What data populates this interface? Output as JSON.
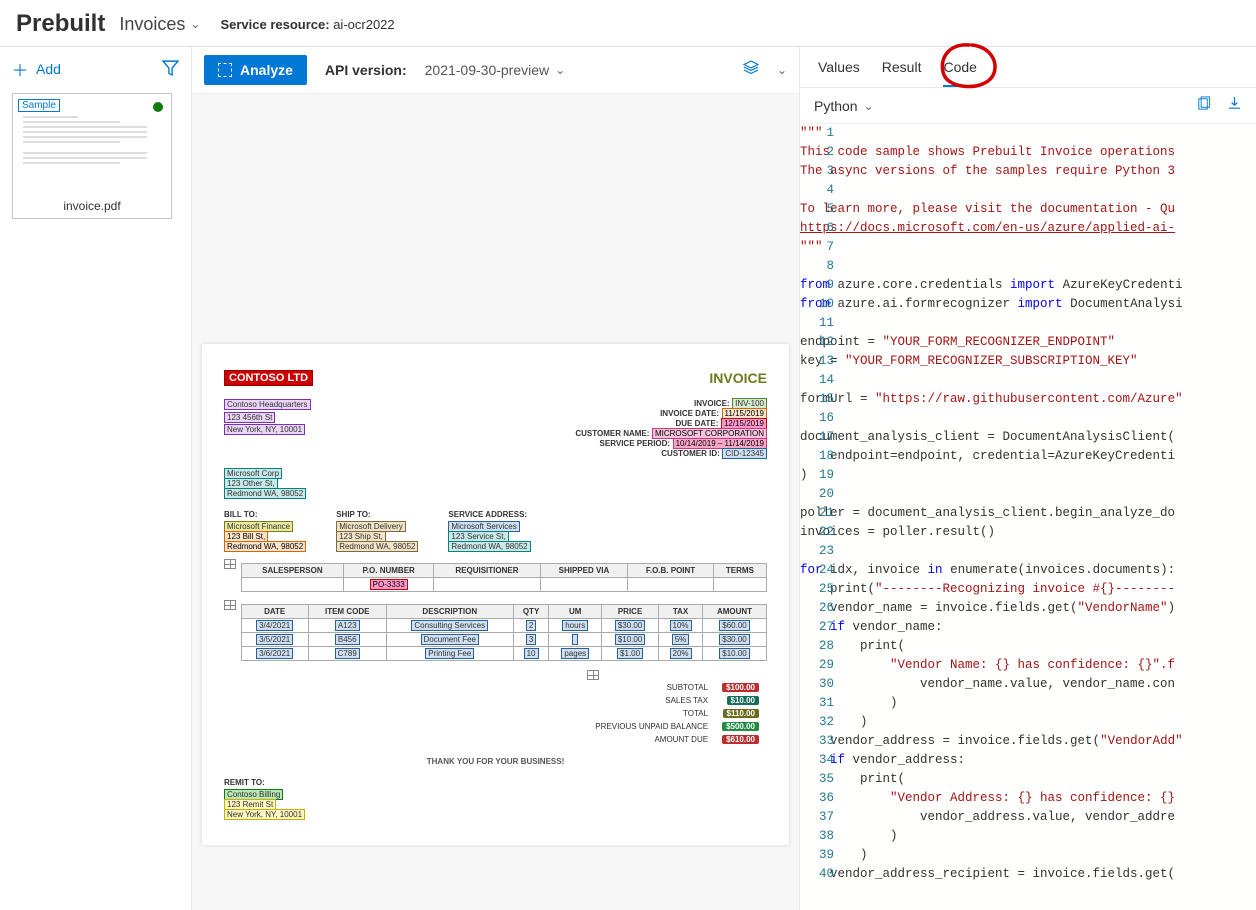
{
  "header": {
    "title": "Prebuilt",
    "dropdown": "Invoices",
    "resource_label": "Service resource:",
    "resource_value": "ai-ocr2022"
  },
  "sidebar": {
    "add_label": "Add",
    "thumb": {
      "badge": "Sample",
      "filename": "invoice.pdf"
    }
  },
  "toolbar": {
    "analyze": "Analyze",
    "api_label": "API version:",
    "api_value": "2021-09-30-preview"
  },
  "doc": {
    "logo": "CONTOSO LTD",
    "title": "INVOICE",
    "vendor": {
      "name": "Contoso Headquarters",
      "addr1": "123 456th St",
      "addr2": "New York, NY, 10001"
    },
    "meta": {
      "invoice_lbl": "INVOICE:",
      "invoice_val": "INV-100",
      "invdate_lbl": "INVOICE DATE:",
      "invdate_val": "11/15/2019",
      "due_lbl": "DUE DATE:",
      "due_val": "12/15/2019",
      "cust_lbl": "CUSTOMER NAME:",
      "cust_val": "MICROSOFT CORPORATION",
      "svc_lbl": "SERVICE PERIOD:",
      "svc_val": "10/14/2019 – 11/14/2019",
      "cid_lbl": "CUSTOMER ID:",
      "cid_val": "CID-12345"
    },
    "customer": {
      "name": "Microsoft Corp",
      "addr1": "123 Other St,",
      "addr2": "Redmond WA, 98052"
    },
    "billto": {
      "lbl": "BILL TO:",
      "name": "Microsoft Finance",
      "addr1": "123 Bill St,",
      "addr2": "Redmond WA, 98052"
    },
    "shipto": {
      "lbl": "SHIP TO:",
      "name": "Microsoft Delivery",
      "addr1": "123 Ship St,",
      "addr2": "Redmond WA, 98052"
    },
    "svcaddr": {
      "lbl": "SERVICE ADDRESS:",
      "name": "Microsoft Services",
      "addr1": "123 Service St,",
      "addr2": "Redmond WA, 98052"
    },
    "t1": {
      "h": [
        "SALESPERSON",
        "P.O. NUMBER",
        "REQUISITIONER",
        "SHIPPED VIA",
        "F.O.B. POINT",
        "TERMS"
      ],
      "r": [
        "",
        "PO-3333",
        "",
        "",
        "",
        ""
      ]
    },
    "t2": {
      "h": [
        "DATE",
        "ITEM CODE",
        "DESCRIPTION",
        "QTY",
        "UM",
        "PRICE",
        "TAX",
        "AMOUNT"
      ],
      "rows": [
        [
          "3/4/2021",
          "A123",
          "Consulting Services",
          "2",
          "hours",
          "$30.00",
          "10%",
          "$60.00"
        ],
        [
          "3/5/2021",
          "B456",
          "Document Fee",
          "3",
          "",
          "$10.00",
          "5%",
          "$30.00"
        ],
        [
          "3/6/2021",
          "C789",
          "Printing Fee",
          "10",
          "pages",
          "$1.00",
          "20%",
          "$10.00"
        ]
      ]
    },
    "totals": {
      "subtotal_lbl": "SUBTOTAL",
      "subtotal": "$100.00",
      "tax_lbl": "SALES TAX",
      "tax": "$10.00",
      "total_lbl": "TOTAL",
      "total": "$110.00",
      "prev_lbl": "PREVIOUS UNPAID BALANCE",
      "prev": "$500.00",
      "due_lbl": "AMOUNT DUE",
      "due": "$610.00"
    },
    "thanks": "THANK YOU FOR YOUR BUSINESS!",
    "remit": {
      "lbl": "REMIT TO:",
      "name": "Contoso Billing",
      "addr1": "123 Remit St",
      "addr2": "New York, NY, 10001"
    }
  },
  "right": {
    "tabs": {
      "values": "Values",
      "result": "Result",
      "code": "Code"
    },
    "lang": "Python"
  },
  "code": {
    "lines": [
      {
        "n": 1,
        "t": "\"\"\"",
        "c": "comment"
      },
      {
        "n": 2,
        "t": "This code sample shows Prebuilt Invoice operations",
        "c": "comment"
      },
      {
        "n": 3,
        "t": "The async versions of the samples require Python 3",
        "c": "comment"
      },
      {
        "n": 4,
        "t": "",
        "c": ""
      },
      {
        "n": 5,
        "t": "To learn more, please visit the documentation - Qu",
        "c": "comment"
      },
      {
        "n": 6,
        "t": "https://docs.microsoft.com/en-us/azure/applied-ai-",
        "c": "url"
      },
      {
        "n": 7,
        "t": "\"\"\"",
        "c": "comment"
      },
      {
        "n": 8,
        "t": "",
        "c": ""
      },
      {
        "n": 9,
        "t": "from azure.core.credentials import AzureKeyCredenti",
        "c": "kw"
      },
      {
        "n": 10,
        "t": "from azure.ai.formrecognizer import DocumentAnalysi",
        "c": "kw"
      },
      {
        "n": 11,
        "t": "",
        "c": ""
      },
      {
        "n": 12,
        "t": "endpoint = \"YOUR_FORM_RECOGNIZER_ENDPOINT\"",
        "c": "assign"
      },
      {
        "n": 13,
        "t": "key = \"YOUR_FORM_RECOGNIZER_SUBSCRIPTION_KEY\"",
        "c": "assign"
      },
      {
        "n": 14,
        "t": "",
        "c": ""
      },
      {
        "n": 15,
        "t": "formUrl = \"https://raw.githubusercontent.com/Azure",
        "c": "assign-url"
      },
      {
        "n": 16,
        "t": "",
        "c": ""
      },
      {
        "n": 17,
        "t": "document_analysis_client = DocumentAnalysisClient(",
        "c": "plain"
      },
      {
        "n": 18,
        "t": "    endpoint=endpoint, credential=AzureKeyCredenti",
        "c": "plain"
      },
      {
        "n": 19,
        "t": ")",
        "c": "plain"
      },
      {
        "n": 20,
        "t": "",
        "c": ""
      },
      {
        "n": 21,
        "t": "poller = document_analysis_client.begin_analyze_do",
        "c": "plain"
      },
      {
        "n": 22,
        "t": "invoices = poller.result()",
        "c": "plain"
      },
      {
        "n": 23,
        "t": "",
        "c": ""
      },
      {
        "n": 24,
        "t": "for idx, invoice in enumerate(invoices.documents):",
        "c": "kw"
      },
      {
        "n": 25,
        "t": "    print(\"--------Recognizing invoice #{}--------",
        "c": "print"
      },
      {
        "n": 26,
        "t": "    vendor_name = invoice.fields.get(\"VendorName\")",
        "c": "assign"
      },
      {
        "n": 27,
        "t": "    if vendor_name:",
        "c": "kw"
      },
      {
        "n": 28,
        "t": "        print(",
        "c": "plain"
      },
      {
        "n": 29,
        "t": "            \"Vendor Name: {} has confidence: {}\".f",
        "c": "str"
      },
      {
        "n": 30,
        "t": "                vendor_name.value, vendor_name.con",
        "c": "plain"
      },
      {
        "n": 31,
        "t": "            )",
        "c": "plain"
      },
      {
        "n": 32,
        "t": "        )",
        "c": "plain"
      },
      {
        "n": 33,
        "t": "    vendor_address = invoice.fields.get(\"VendorAdd",
        "c": "assign"
      },
      {
        "n": 34,
        "t": "    if vendor_address:",
        "c": "kw"
      },
      {
        "n": 35,
        "t": "        print(",
        "c": "plain"
      },
      {
        "n": 36,
        "t": "            \"Vendor Address: {} has confidence: {}",
        "c": "str"
      },
      {
        "n": 37,
        "t": "                vendor_address.value, vendor_addre",
        "c": "plain"
      },
      {
        "n": 38,
        "t": "            )",
        "c": "plain"
      },
      {
        "n": 39,
        "t": "        )",
        "c": "plain"
      },
      {
        "n": 40,
        "t": "    vendor_address_recipient = invoice.fields.get(",
        "c": "assign"
      }
    ]
  }
}
